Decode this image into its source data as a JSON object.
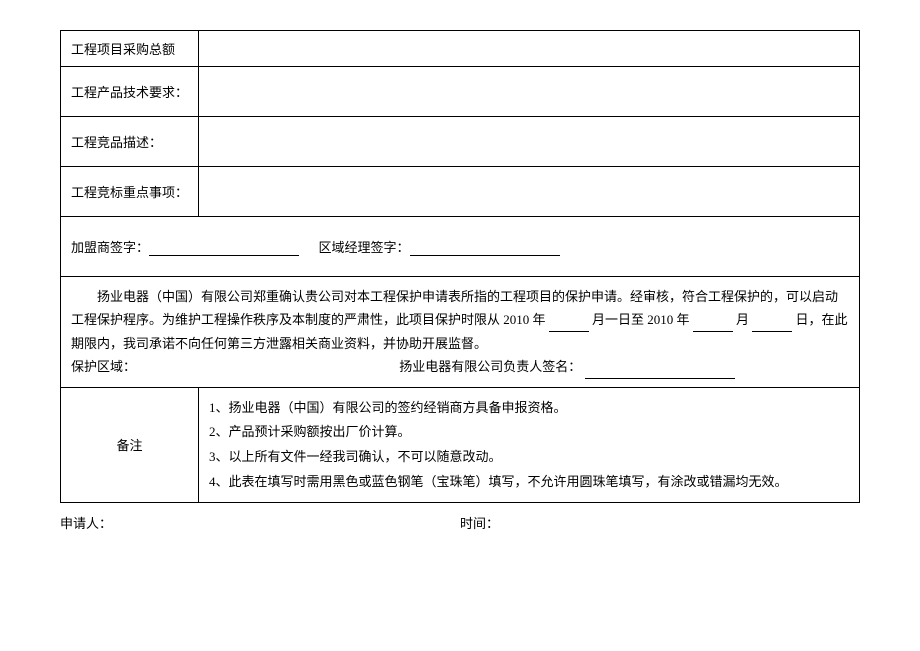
{
  "rows": {
    "total": "工程项目采购总额",
    "tech": "工程产品技术要求：",
    "desc": "工程竞品描述：",
    "bid": "工程竞标重点事项：",
    "franchisee_sig": "加盟商签字：",
    "region_mgr_sig": "区域经理签字：",
    "notes_label": "备注"
  },
  "declaration": {
    "p1a": "扬业电器（中国）有限公司郑重确认贵公司对本工程保护申请表所指的工程项目的保护申请。经审核，符合工程保护的，可以启动工程保护程序。为维护工程操作秩序及本制度的严肃性，此项目保护时限从 2010 年",
    "p1b": "月一日至 2010 年",
    "p1c": "月",
    "p1d": "日，在此期限内，我司承诺不向任何第三方泄露相关商业资料，并协助开展监督。",
    "protect_region": "保护区域：",
    "company_sig": "扬业电器有限公司负责人签名："
  },
  "notes": {
    "n1": "1、扬业电器（中国）有限公司的签约经销商方具备申报资格。",
    "n2": "2、产品预计采购额按出厂价计算。",
    "n3": "3、以上所有文件一经我司确认，不可以随意改动。",
    "n4": "4、此表在填写时需用黑色或蓝色钢笔（宝珠笔）填写，不允许用圆珠笔填写，有涂改或错漏均无效。"
  },
  "footer": {
    "applicant": "申请人：",
    "time": "时间："
  }
}
